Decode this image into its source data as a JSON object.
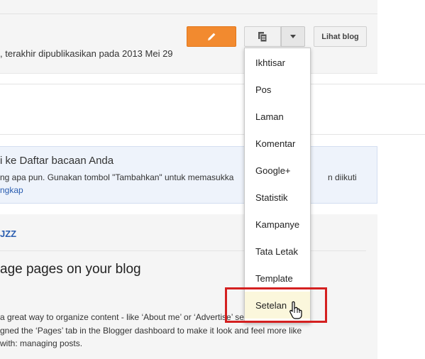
{
  "header": {
    "view_blog_label": "Lihat blog",
    "published_text": ", terakhir dipublikasikan pada 2013 Mei 29",
    "icons": [
      "pencil-icon",
      "copy-icon",
      "caret-down-icon"
    ],
    "accent_color": "#f28a2f"
  },
  "reading_list": {
    "title": "i ke Daftar bacaan Anda",
    "body": "ng apa pun. Gunakan tombol \"Tambahkan\" untuk memasukka",
    "body_tail": "n diikuti",
    "link": "ngkap"
  },
  "post": {
    "source": "JZZ",
    "title": "age pages on your blog",
    "lines": [
      "a great way to organize content - like ‘About me’ or ‘Advertise’ sections. To make",
      "gned the ‘Pages’ tab in the Blogger dashboard to make it look and feel more like",
      "with: managing posts."
    ]
  },
  "menu": {
    "items": [
      "Ikhtisar",
      "Pos",
      "Laman",
      "Komentar",
      "Google+",
      "Statistik",
      "Kampanye",
      "Tata Letak",
      "Template",
      "Setelan"
    ],
    "hovered": "Setelan",
    "highlight_color": "#d42020"
  }
}
